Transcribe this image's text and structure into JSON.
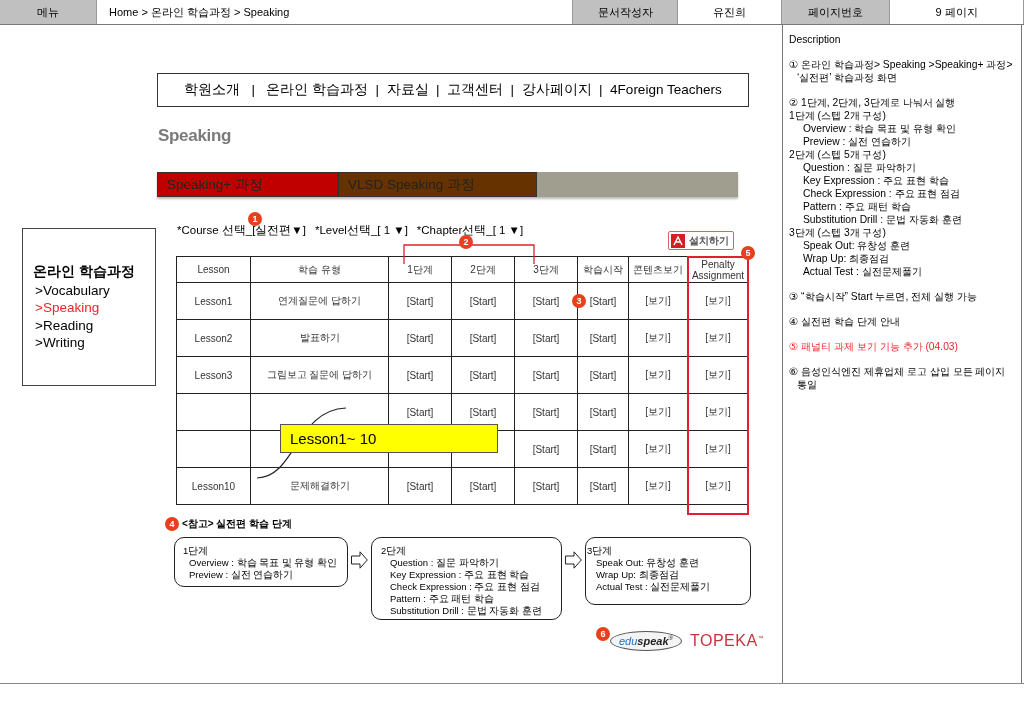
{
  "header": {
    "menu_label": "메뉴",
    "breadcrumb": "Home > 온라인 학습과정 > Speaking",
    "author_label": "문서작성자",
    "author": "유진희",
    "page_label": "페이지번호",
    "page": "9 페이지"
  },
  "nav_menu": "학원소개   |   온라인 학습과정  |  자료실  |  고객센터  |  강사페이지  |  4Foreign Teachers",
  "page_title": "Speaking",
  "course_tabs": [
    {
      "label": "Speaking+ 과정",
      "color": "#c00000"
    },
    {
      "label": "VLSD Speaking 과정",
      "color": "#663300"
    }
  ],
  "sidebar": {
    "title": "온라인 학습과정",
    "items": [
      {
        "label": ">Vocabulary",
        "selected": false
      },
      {
        "label": ">Speaking",
        "selected": true
      },
      {
        "label": ">Reading",
        "selected": false
      },
      {
        "label": ">Writing",
        "selected": false
      }
    ]
  },
  "selectors": {
    "marker": "1",
    "items": [
      "*Course 선택_[실전편▼]",
      "*Level선택_[ 1 ▼]",
      "*Chapter선택_[ 1 ▼]"
    ]
  },
  "install_button": {
    "label": "설치하기"
  },
  "table": {
    "columns": [
      "Lesson",
      "학습 유형",
      "1단계",
      "2단계",
      "3단계",
      "학습시작",
      "콘텐츠보기",
      "Penalty Assignment"
    ],
    "step_marker": "2",
    "start_marker": "3",
    "penalty_marker": "5",
    "rows": [
      {
        "lesson": "Lesson1",
        "type": "연계질문에 답하기",
        "steps": [
          "[Start]",
          "[Start]",
          "[Start]"
        ],
        "start": "[Start]",
        "contents": "[보기]",
        "penalty": "[보기]"
      },
      {
        "lesson": "Lesson2",
        "type": "발표하기",
        "steps": [
          "[Start]",
          "[Start]",
          "[Start]"
        ],
        "start": "[Start]",
        "contents": "[보기]",
        "penalty": "[보기]"
      },
      {
        "lesson": "Lesson3",
        "type": "그림보고 질문에 답하기",
        "steps": [
          "[Start]",
          "[Start]",
          "[Start]"
        ],
        "start": "[Start]",
        "contents": "[보기]",
        "penalty": "[보기]"
      },
      {
        "steps": [
          "[Start]",
          "[Start]",
          "[Start]"
        ],
        "start": "[Start]",
        "contents": "[보기]",
        "penalty": "[보기]"
      },
      {
        "covered": true,
        "steps": [
          "[Start]"
        ],
        "start": "[Start]",
        "contents": "[보기]",
        "penalty": "[보기]"
      },
      {
        "lesson": "Lesson10",
        "type": "문제해결하기",
        "steps": [
          "[Start]",
          "[Start]",
          "[Start]"
        ],
        "start": "[Start]",
        "contents": "[보기]",
        "penalty": "[보기]"
      }
    ]
  },
  "callout": "Lesson1~ 10",
  "steps_note": {
    "marker": "4",
    "title": "<참고> 실전편 학습 단계",
    "steps": [
      {
        "title": "1단계",
        "lines": [
          "Overview : 학습 목표 및 유형 확인",
          "Preview : 실전 연습하기"
        ]
      },
      {
        "title": "2단계",
        "lines": [
          "Question : 질문 파악하기",
          "Key Expression : 주요 표현 학습",
          "Check Expression : 주요 표현 점검",
          "Pattern : 주요 패턴 학습",
          "Substitution Drill : 문법 자동화 훈련"
        ]
      },
      {
        "title": "3단계",
        "lines": [
          "Speak Out: 유창성 훈련",
          "Wrap Up: 최종점검",
          "Actual Test : 실전문제풀기"
        ]
      }
    ]
  },
  "logos": {
    "marker": "6",
    "items": [
      {
        "kind": "eduspeak",
        "text": "edu**speak**$^{®}$"
      },
      {
        "kind": "topeka",
        "text": "TOPEKA$^{™}$"
      }
    ]
  },
  "description": {
    "title": "Description",
    "blocks": [
      {
        "highlighted": false,
        "lines": [
          {
            "text": "① 온라인 학습과정> Speaking >Speaking+ 과정> ‘실전편’ 학습과정 화면"
          }
        ]
      },
      {
        "highlighted": false,
        "lines": [
          {
            "text": "② 1단계, 2단계, 3단계로 나눠서 실행"
          },
          {
            "text": "1단계 (스텝 2개 구성)",
            "children": [
              {
                "text": "Overview : 학습 목표 및 유형 확인"
              },
              {
                "text": "Preview : 실전 연습하기"
              }
            ]
          },
          {
            "text": "2단계 (스텝 5개 구성)",
            "children": [
              {
                "text": "Question : 질문 파악하기"
              },
              {
                "text": "Key Expression : 주요 표현 학습"
              },
              {
                "text": "Check Expression : 주요 표현 점검"
              },
              {
                "text": "Pattern : 주요 패턴 학습"
              },
              {
                "text": "Substitution Drill : 문법 자동화 훈련"
              }
            ]
          },
          {
            "text": "3단계 (스텝 3개 구성)",
            "children": [
              {
                "text": "Speak Out: 유창성 훈련"
              },
              {
                "text": "Wrap Up: 최종점검"
              },
              {
                "text": "Actual Test : 실전문제풀기"
              }
            ]
          }
        ]
      },
      {
        "highlighted": false,
        "lines": [
          {
            "text": "③ “학습시작” Start 누르면, 전체 실행 가능"
          }
        ]
      },
      {
        "highlighted": false,
        "lines": [
          {
            "text": "④ 실전편 학습 단계 안내"
          }
        ]
      },
      {
        "highlighted": true,
        "lines": [
          {
            "text": "⑤ 패널티 과제 보기 기능 추가 (04.03)"
          }
        ]
      },
      {
        "highlighted": false,
        "lines": [
          {
            "text": "⑥ 음성인식엔진 제휴업체 로고 삽입 모든 페이지 통일"
          }
        ]
      }
    ]
  }
}
